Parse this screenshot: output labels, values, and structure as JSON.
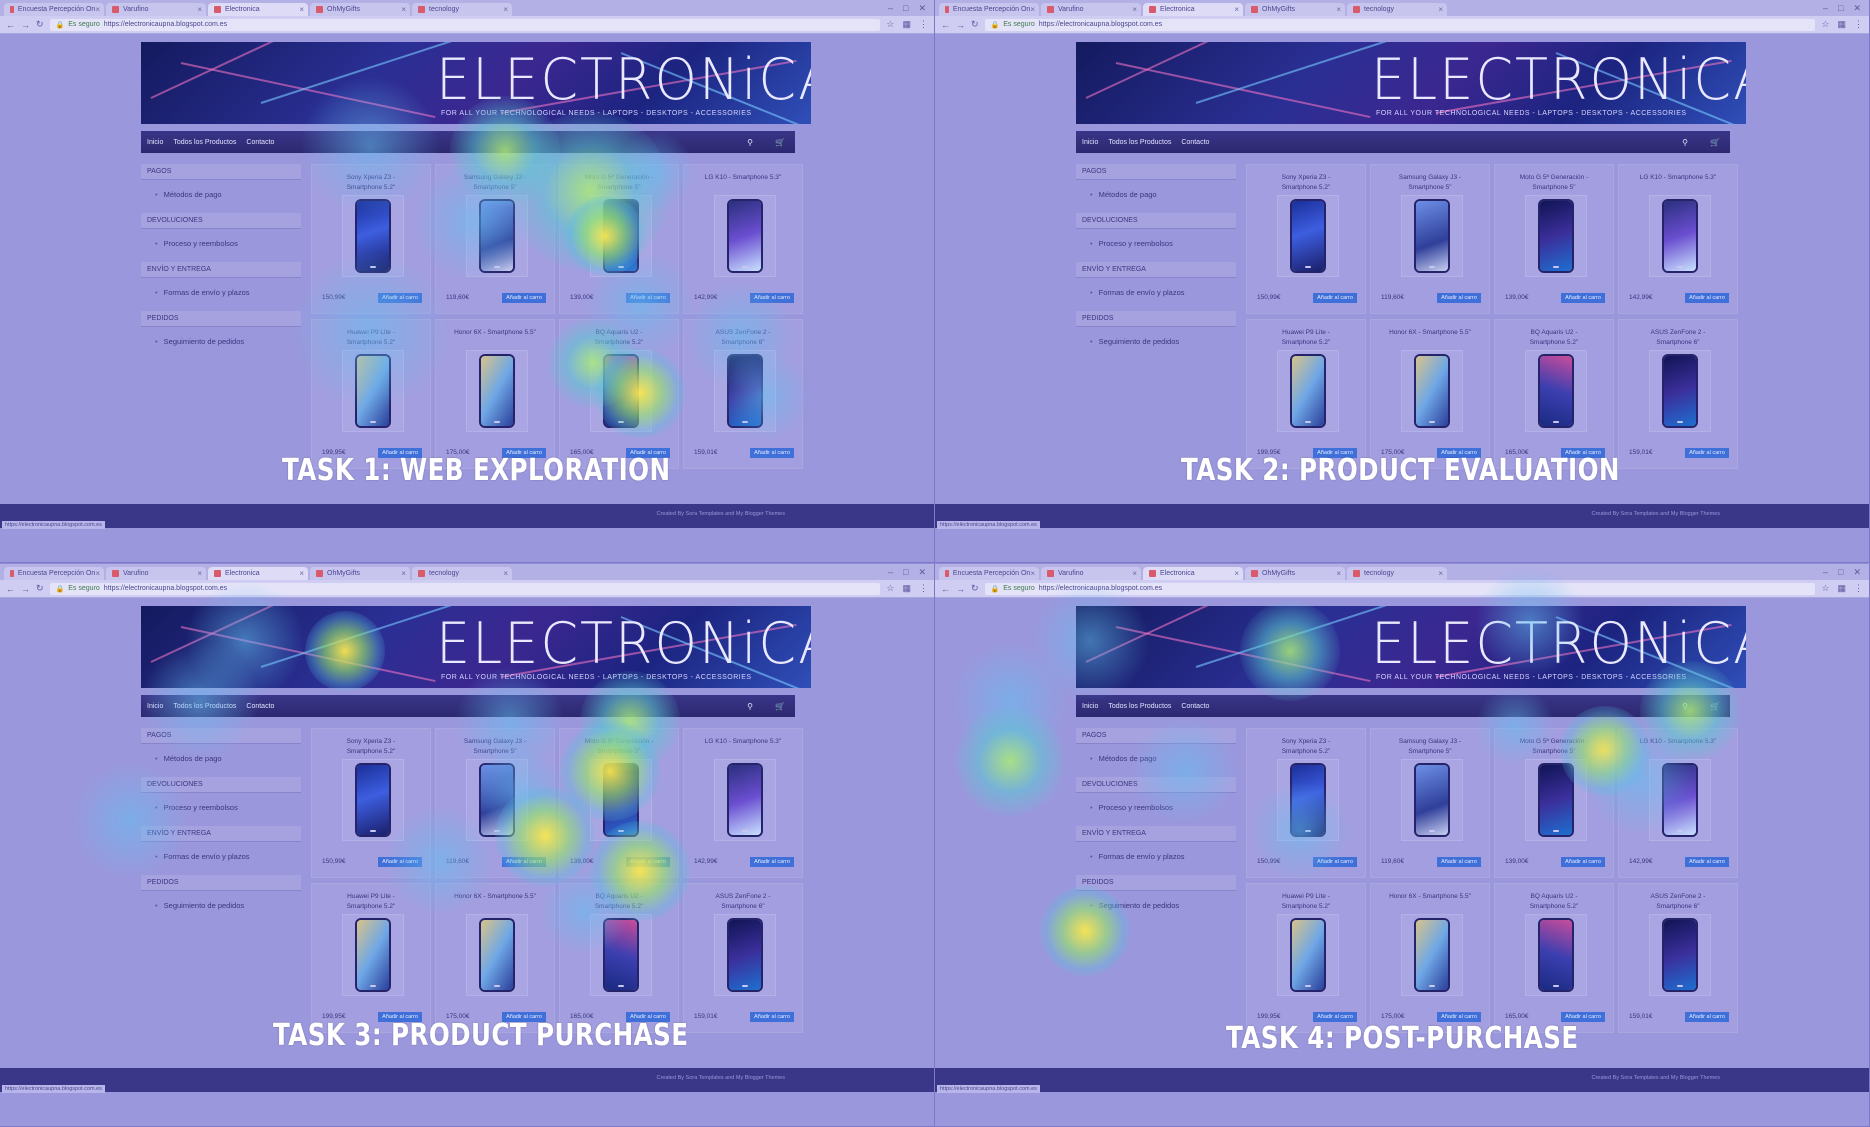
{
  "browser": {
    "tabs": [
      "Encuesta Percepción On",
      "Varufino",
      "Electronica",
      "OhMyGifts",
      "tecnology"
    ],
    "active_tab": 2,
    "secure_label": "Es seguro",
    "url": "https://electronicaupna.blogspot.com.es",
    "status_url": "https://electronicaupna.blogspot.com.es"
  },
  "site": {
    "banner_title": "ELECTRONiCA",
    "banner_tagline": "FOR ALL YOUR TECHNOLOGICAL NEEDS - LAPTOPS - DESKTOPS - ACCESSORIES",
    "menu": [
      "Inicio",
      "Todos los Productos",
      "Contacto"
    ],
    "search_icon": "search-icon",
    "cart_icon": "cart-icon",
    "sidebar": [
      {
        "heading": "PAGOS",
        "item": "Métodos de pago"
      },
      {
        "heading": "DEVOLUCIONES",
        "item": "Proceso y reembolsos"
      },
      {
        "heading": "ENVÍO Y ENTREGA",
        "item": "Formas de envío y plazos"
      },
      {
        "heading": "PEDIDOS",
        "item": "Seguimiento de pedidos"
      }
    ],
    "add_to_cart_label": "Añadir al carro",
    "products": [
      {
        "name1": "Sony Xperia Z3 -",
        "name2": "Smartphone 5.2\"",
        "price": "150,99€"
      },
      {
        "name1": "Samsung Galaxy J3 -",
        "name2": "Smartphone 5\"",
        "price": "119,60€"
      },
      {
        "name1": "Moto G 5ª Generación -",
        "name2": "Smartphone 5\"",
        "price": "139,00€"
      },
      {
        "name1": "LG K10 - Smartphone 5.3\"",
        "name2": "",
        "price": "142,99€"
      },
      {
        "name1": "Huawei P9 Lite -",
        "name2": "Smartphone 5.2\"",
        "price": "199,95€"
      },
      {
        "name1": "Honor 6X - Smartphone 5.5\"",
        "name2": "",
        "price": "175,00€"
      },
      {
        "name1": "BQ Aquaris U2 -",
        "name2": "Smartphone 5.2\"",
        "price": "165,00€"
      },
      {
        "name1": "ASUS ZenFone 2 -",
        "name2": "Smartphone 6\"",
        "price": "159,01€"
      }
    ],
    "footer_text": "Created By Sora Templates and My Blogger Themes"
  },
  "panels": [
    {
      "label": "TASK 1: WEB EXPLORATION"
    },
    {
      "label": "TASK 2: PRODUCT EVALUATION"
    },
    {
      "label": "TASK 3: PRODUCT PURCHASE"
    },
    {
      "label": "TASK 4: POST-PURCHASE"
    }
  ]
}
